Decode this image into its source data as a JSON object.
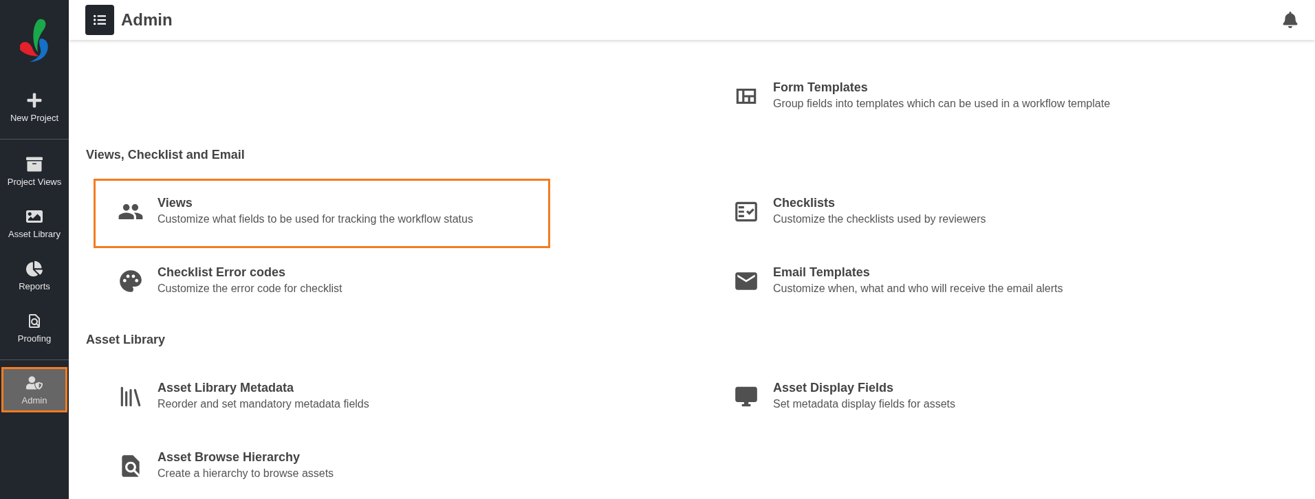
{
  "sidebar": {
    "groups": [
      [
        {
          "label": "New Project",
          "selected": false
        }
      ],
      [
        {
          "label": "Project Views",
          "selected": false
        },
        {
          "label": "Asset Library",
          "selected": false
        },
        {
          "label": "Reports",
          "selected": false
        },
        {
          "label": "Proofing",
          "selected": false
        }
      ],
      [
        {
          "label": "Admin",
          "selected": true
        }
      ]
    ]
  },
  "header": {
    "title": "Admin"
  },
  "sections": [
    {
      "rows": [
        {
          "right": {
            "title": "Form Templates",
            "description": "Group fields into templates which can be used in a workflow template",
            "highlighted": false
          }
        }
      ]
    },
    {
      "heading": "Views, Checklist and Email",
      "rows": [
        {
          "left": {
            "title": "Views",
            "description": "Customize what fields to be used for tracking the workflow status",
            "highlighted": true
          },
          "right": {
            "title": "Checklists",
            "description": "Customize the checklists used by reviewers",
            "highlighted": false
          }
        },
        {
          "left": {
            "title": "Checklist Error codes",
            "description": "Customize the error code for checklist",
            "highlighted": false
          },
          "right": {
            "title": "Email Templates",
            "description": "Customize when, what and who will receive the email alerts",
            "highlighted": false
          }
        }
      ]
    },
    {
      "heading": "Asset Library",
      "rows": [
        {
          "left": {
            "title": "Asset Library Metadata",
            "description": "Reorder and set mandatory metadata fields",
            "highlighted": false
          },
          "right": {
            "title": "Asset Display Fields",
            "description": "Set metadata display fields for assets",
            "highlighted": false
          }
        },
        {
          "left": {
            "title": "Asset Browse Hierarchy",
            "description": "Create a hierarchy to browse assets",
            "highlighted": false
          }
        }
      ]
    }
  ]
}
